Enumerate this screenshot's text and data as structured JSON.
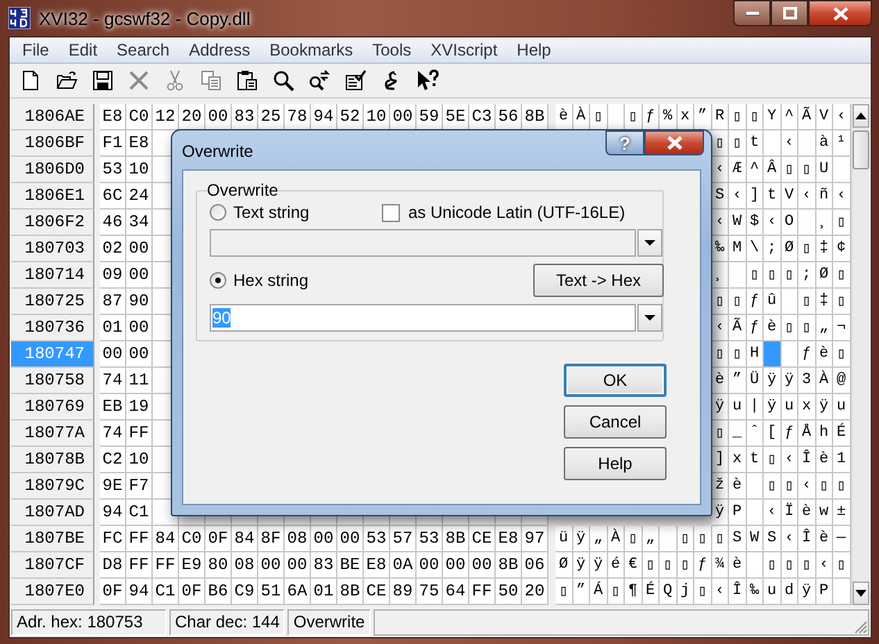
{
  "window": {
    "title": "XVI32 - gcswf32 - Copy.dll"
  },
  "menu": [
    "File",
    "Edit",
    "Search",
    "Address",
    "Bookmarks",
    "Tools",
    "XVIscript",
    "Help"
  ],
  "toolbar": [
    {
      "kind": "new",
      "disabled": false
    },
    {
      "kind": "open",
      "disabled": false
    },
    {
      "kind": "save",
      "disabled": false
    },
    {
      "kind": "delete",
      "disabled": true
    },
    {
      "kind": "cut",
      "disabled": true
    },
    {
      "kind": "copy",
      "disabled": true
    },
    {
      "kind": "paste",
      "disabled": false
    },
    {
      "kind": "find",
      "disabled": false
    },
    {
      "kind": "find-again",
      "disabled": false
    },
    {
      "kind": "properties",
      "disabled": false
    },
    {
      "kind": "script",
      "disabled": false
    },
    {
      "kind": "context-help",
      "disabled": false
    }
  ],
  "grid": {
    "rows": [
      {
        "address": "1806AE",
        "selected": false,
        "hex": [
          "E8",
          "C0",
          "12",
          "20",
          "00",
          "83",
          "25",
          "78",
          "94",
          "52",
          "10",
          "00",
          "59",
          "5E",
          "C3",
          "56",
          "8B"
        ],
        "ascii": [
          "è",
          "À",
          "▯",
          {
            "kind": "blank"
          },
          "▯",
          "ƒ",
          "%",
          "x",
          "”",
          "R",
          "▯",
          "▯",
          "Y",
          "^",
          "Ã",
          "V",
          "‹"
        ]
      },
      {
        "address": "1806BF",
        "selected": false,
        "hex": [
          "F1",
          "E8"
        ],
        "ascii": [
          "▯",
          "▯",
          "t",
          {
            "kind": "blank"
          },
          "‹",
          {
            "kind": "blank"
          },
          "à",
          "¹"
        ]
      },
      {
        "address": "1806D0",
        "selected": false,
        "hex": [
          "53",
          "10"
        ],
        "ascii": [
          "‹",
          "Æ",
          "^",
          "Â",
          "▯",
          "▯",
          "U",
          {
            "kind": "blank"
          }
        ]
      },
      {
        "address": "1806E1",
        "selected": false,
        "hex": [
          "6C",
          "24"
        ],
        "ascii": [
          "S",
          "‹",
          "]",
          "t",
          "V",
          "‹",
          "ñ",
          "‹"
        ]
      },
      {
        "address": "1806F2",
        "selected": false,
        "hex": [
          "46",
          "34"
        ],
        "ascii": [
          "‹",
          "W",
          "$",
          "‹",
          "O",
          {
            "kind": "blank"
          },
          "¸",
          "▯"
        ]
      },
      {
        "address": "180703",
        "selected": false,
        "hex": [
          "02",
          "00"
        ],
        "ascii": [
          "‰",
          "M",
          "\\",
          ";",
          "Ø",
          "▯",
          "‡",
          "¢"
        ]
      },
      {
        "address": "180714",
        "selected": false,
        "hex": [
          "09",
          "00"
        ],
        "ascii": [
          "¸",
          {
            "kind": "blank"
          },
          "▯",
          "▯",
          "▯",
          ";",
          "Ø",
          "▯"
        ]
      },
      {
        "address": "180725",
        "selected": false,
        "hex": [
          "87",
          "90"
        ],
        "ascii": [
          "▯",
          "▯",
          "ƒ",
          "û",
          {
            "kind": "blank"
          },
          "▯",
          "‡",
          "▯"
        ]
      },
      {
        "address": "180736",
        "selected": false,
        "hex": [
          "01",
          "00"
        ],
        "ascii": [
          "‹",
          "Ã",
          "ƒ",
          "è",
          "▯",
          "▯",
          "„",
          "¬"
        ]
      },
      {
        "address": "180747",
        "selected": true,
        "hex": [
          "00",
          "00"
        ],
        "ascii": [
          "▯",
          "▯",
          "H",
          {
            "kind": "cursor"
          },
          {
            "kind": "blank"
          },
          "ƒ",
          "è",
          "▯"
        ]
      },
      {
        "address": "180758",
        "selected": false,
        "hex": [
          "74",
          "11"
        ],
        "ascii": [
          "è",
          "”",
          "Ü",
          "ÿ",
          "ÿ",
          "3",
          "À",
          "@"
        ]
      },
      {
        "address": "180769",
        "selected": false,
        "hex": [
          "EB",
          "19"
        ],
        "ascii": [
          "ÿ",
          "u",
          "|",
          "ÿ",
          "u",
          "x",
          "ÿ",
          "u"
        ]
      },
      {
        "address": "18077A",
        "selected": false,
        "hex": [
          "74",
          "FF"
        ],
        "ascii": [
          "▯",
          "_",
          "ˆ",
          "[",
          "ƒ",
          "Å",
          "h",
          "É"
        ]
      },
      {
        "address": "18078B",
        "selected": false,
        "hex": [
          "C2",
          "10"
        ],
        "ascii": [
          "]",
          "x",
          "t",
          "▯",
          "‹",
          "Î",
          "è",
          "1"
        ]
      },
      {
        "address": "18079C",
        "selected": false,
        "hex": [
          "9E",
          "F7"
        ],
        "ascii": [
          "ž",
          "è",
          {
            "kind": "blank"
          },
          "▯",
          "▯",
          "‹",
          "▯",
          "▯"
        ]
      },
      {
        "address": "1807AD",
        "selected": false,
        "hex": [
          "94",
          "C1"
        ],
        "ascii": [
          "ÿ",
          "P",
          {
            "kind": "blank"
          },
          "‹",
          "Ï",
          "è",
          "w",
          "±"
        ]
      },
      {
        "address": "1807BE",
        "selected": false,
        "hex": [
          "FC",
          "FF",
          "84",
          "C0",
          "0F",
          "84",
          "8F",
          "08",
          "00",
          "00",
          "53",
          "57",
          "53",
          "8B",
          "CE",
          "E8",
          "97"
        ],
        "ascii": [
          "ü",
          "ÿ",
          "„",
          "À",
          "▯",
          "„",
          {
            "kind": "blank"
          },
          "▯",
          "▯",
          "▯",
          "S",
          "W",
          "S",
          "‹",
          "Î",
          "è",
          "—"
        ]
      },
      {
        "address": "1807CF",
        "selected": false,
        "hex": [
          "D8",
          "FF",
          "FF",
          "E9",
          "80",
          "08",
          "00",
          "00",
          "83",
          "BE",
          "E8",
          "0A",
          "00",
          "00",
          "00",
          "8B",
          "06"
        ],
        "ascii": [
          "Ø",
          "ÿ",
          "ÿ",
          "é",
          "€",
          "▯",
          "▯",
          "▯",
          "ƒ",
          "¾",
          "è",
          {
            "kind": "blank"
          },
          "▯",
          "▯",
          "▯",
          "‹",
          "▯"
        ]
      },
      {
        "address": "1807E0",
        "selected": false,
        "hex": [
          "0F",
          "94",
          "C1",
          "0F",
          "B6",
          "C9",
          "51",
          "6A",
          "01",
          "8B",
          "CE",
          "89",
          "75",
          "64",
          "FF",
          "50",
          "20"
        ],
        "ascii": [
          "▯",
          "”",
          "Á",
          "▯",
          "¶",
          "É",
          "Q",
          "j",
          "▯",
          "‹",
          "Î",
          "‰",
          "u",
          "d",
          "ÿ",
          "P",
          {
            "kind": "blank"
          }
        ]
      }
    ]
  },
  "status_bar": [
    "Adr. hex: 180753",
    "Char dec: 144",
    "Overwrite"
  ],
  "dialog": {
    "title": "Overwrite",
    "help_glyph": "?",
    "group": "Overwrite",
    "options": [
      {
        "label": "Text string",
        "selected": false
      },
      {
        "label": "Hex string",
        "selected": true
      }
    ],
    "unicode_checkbox": {
      "label": "as Unicode Latin (UTF-16LE)",
      "checked": false
    },
    "text_field": {
      "disabled": true
    },
    "convert_button": {
      "label": "Text -> Hex"
    },
    "hex_field": {
      "value": "90",
      "value_selected": true
    },
    "buttons": [
      {
        "label": "OK",
        "default": true
      },
      {
        "label": "Cancel",
        "default": false
      },
      {
        "label": "Help",
        "default": false
      }
    ]
  }
}
